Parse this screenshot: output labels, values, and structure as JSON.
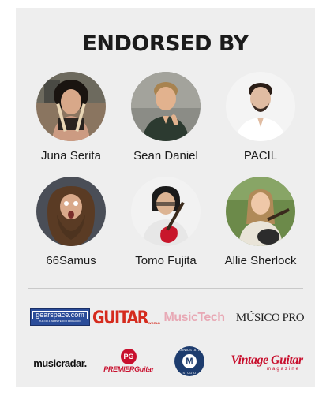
{
  "title": "ENDORSED BY",
  "endorsers": [
    {
      "name": "Juna Serita"
    },
    {
      "name": "Sean Daniel"
    },
    {
      "name": "PACIL"
    },
    {
      "name": "66Samus"
    },
    {
      "name": "Tomo Fujita"
    },
    {
      "name": "Allie Sherlock"
    }
  ],
  "logos": {
    "gearspace": {
      "main": "gearspace.com",
      "tag": "THE NO.1 WEBSITE FOR PRO AUDIO",
      "color": "#2b4d9a"
    },
    "guitar_world": {
      "main": "GUITAR",
      "sub": "WORLD",
      "color": "#d52b1e"
    },
    "musictech": {
      "main": "MusicTech",
      "color": "#e8a9b5"
    },
    "musico_pro": {
      "main": "MÚSICO PRO",
      "color": "#222222"
    },
    "musicradar": {
      "main": "musicradar.",
      "color": "#111111"
    },
    "premier_guitar": {
      "badge": "PG",
      "main": "PREMIERGuitar",
      "color": "#c8102e"
    },
    "sonicstate": {
      "badge": "M",
      "ring": "SONICSTATE",
      "ring2": "STUDIO",
      "color": "#1d3c6e"
    },
    "vintage_guitar": {
      "main": "Vintage Guitar",
      "sub": "magazine",
      "color": "#c8102e"
    }
  }
}
